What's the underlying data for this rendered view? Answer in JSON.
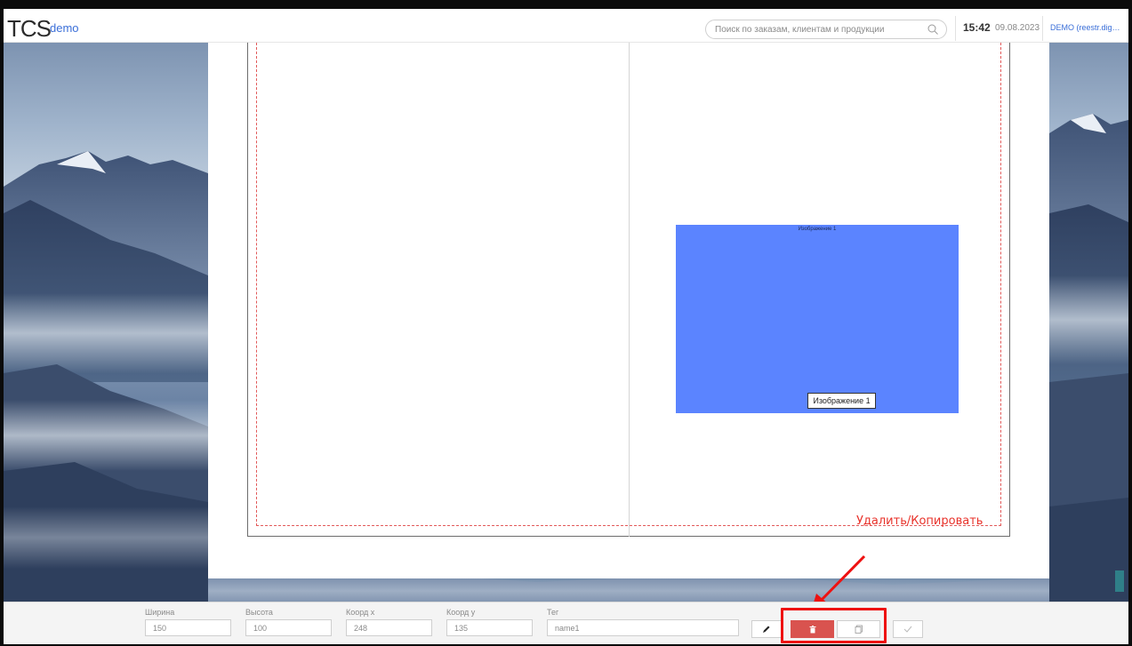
{
  "header": {
    "logo": "TCS",
    "logo_sub": "demo",
    "search_placeholder": "Поиск по заказам, клиентам и продукции",
    "time": "15:42",
    "date": "09.08.2023",
    "user": "DEMO (reestr.digit..."
  },
  "canvas": {
    "image_top_label": "Изображение 1",
    "image_label": "Изображение 1",
    "annotation": "Удалить/Копировать",
    "image_color": "#5b84ff"
  },
  "properties": {
    "width": {
      "label": "Ширина",
      "value": "150"
    },
    "height": {
      "label": "Высота",
      "value": "100"
    },
    "x": {
      "label": "Коорд x",
      "value": "248"
    },
    "y": {
      "label": "Коорд y",
      "value": "135"
    },
    "tag": {
      "label": "Тег",
      "value": "name1"
    }
  },
  "actions": {
    "edit_icon": "pencil-icon",
    "delete_icon": "trash-icon",
    "copy_icon": "copy-icon",
    "apply_icon": "check-icon",
    "delete_color": "#d9534f"
  }
}
